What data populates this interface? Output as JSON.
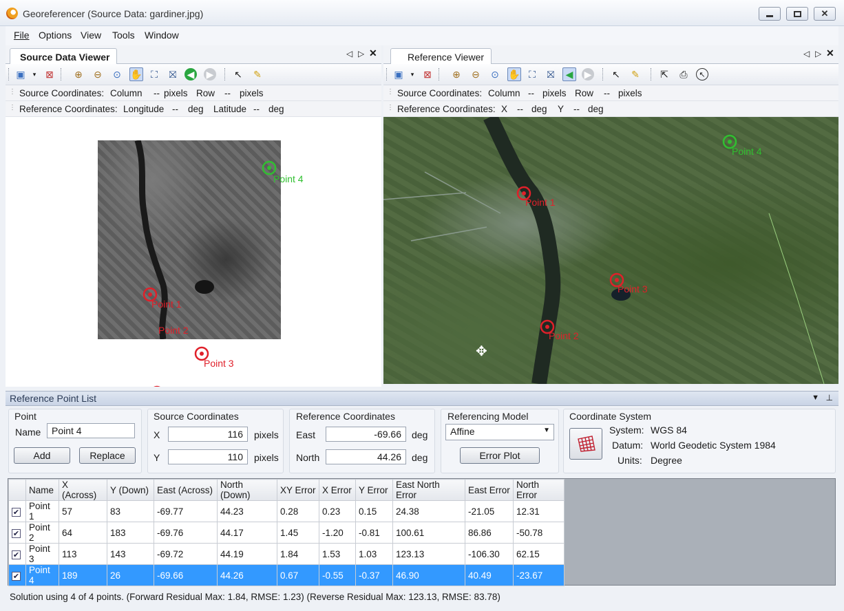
{
  "window": {
    "title": "Georeferencer (Source Data:  gardiner.jpg)"
  },
  "menu": [
    "File",
    "Options",
    "View",
    "Tools",
    "Window"
  ],
  "source_viewer": {
    "tab": "Source Data Viewer",
    "source_coords": {
      "label": "Source Coordinates:",
      "col": "Column",
      "col_val": "--",
      "col_unit": "pixels",
      "row": "Row",
      "row_val": "--",
      "row_unit": "pixels"
    },
    "ref_coords": {
      "label": "Reference Coordinates:",
      "lon": "Longitude",
      "lon_val": "--",
      "lon_unit": "deg",
      "lat": "Latitude",
      "lat_val": "--",
      "lat_unit": "deg"
    },
    "points": [
      {
        "label": "Point 4",
        "color": "green"
      },
      {
        "label": "Point 1",
        "color": "red"
      },
      {
        "label": "Point 3",
        "color": "red"
      },
      {
        "label": "Point 2",
        "color": "red"
      }
    ]
  },
  "reference_viewer": {
    "tab": "Reference Viewer",
    "source_coords": {
      "label": "Source Coordinates:",
      "col": "Column",
      "col_val": "--",
      "col_unit": "pixels",
      "row": "Row",
      "row_val": "--",
      "row_unit": "pixels"
    },
    "ref_coords": {
      "label": "Reference Coordinates:",
      "x": "X",
      "x_val": "--",
      "x_unit": "deg",
      "y": "Y",
      "y_val": "--",
      "y_unit": "deg"
    },
    "points": [
      {
        "label": "Point 4",
        "color": "green"
      },
      {
        "label": "Point 1",
        "color": "red"
      },
      {
        "label": "Point 3",
        "color": "red"
      },
      {
        "label": "Point 2",
        "color": "red"
      }
    ]
  },
  "rpl": {
    "header": "Reference Point List",
    "point": {
      "title": "Point",
      "name_label": "Name",
      "name_value": "Point 4",
      "add": "Add",
      "replace": "Replace"
    },
    "source": {
      "title": "Source Coordinates",
      "x_label": "X",
      "x_value": "116",
      "x_unit": "pixels",
      "y_label": "Y",
      "y_value": "110",
      "y_unit": "pixels"
    },
    "reference": {
      "title": "Reference Coordinates",
      "east_label": "East",
      "east_value": "-69.66",
      "east_unit": "deg",
      "north_label": "North",
      "north_value": "44.26",
      "north_unit": "deg"
    },
    "model": {
      "title": "Referencing Model",
      "selected": "Affine",
      "error_plot": "Error Plot"
    },
    "crs": {
      "title": "Coordinate System",
      "system_label": "System:",
      "system_value": "WGS 84",
      "datum_label": "Datum:",
      "datum_value": "World Geodetic System 1984",
      "units_label": "Units:",
      "units_value": "Degree"
    }
  },
  "table": {
    "columns": [
      "Name",
      "X (Across)",
      "Y (Down)",
      "East (Across)",
      "North (Down)",
      "XY Error",
      "X Error",
      "Y Error",
      "East North Error",
      "East Error",
      "North Error"
    ],
    "rows": [
      [
        "Point 1",
        "57",
        "83",
        "-69.77",
        "44.23",
        "0.28",
        "0.23",
        "0.15",
        "24.38",
        "-21.05",
        "12.31"
      ],
      [
        "Point 2",
        "64",
        "183",
        "-69.76",
        "44.17",
        "1.45",
        "-1.20",
        "-0.81",
        "100.61",
        "86.86",
        "-50.78"
      ],
      [
        "Point 3",
        "113",
        "143",
        "-69.72",
        "44.19",
        "1.84",
        "1.53",
        "1.03",
        "123.13",
        "-106.30",
        "62.15"
      ],
      [
        "Point 4",
        "189",
        "26",
        "-69.66",
        "44.26",
        "0.67",
        "-0.55",
        "-0.37",
        "46.90",
        "40.49",
        "-23.67"
      ]
    ],
    "selected_row": 3
  },
  "status": "Solution using 4 of 4 points.  (Forward Residual Max: 1.84, RMSE: 1.23)  (Reverse Residual Max: 123.13, RMSE: 83.78)"
}
